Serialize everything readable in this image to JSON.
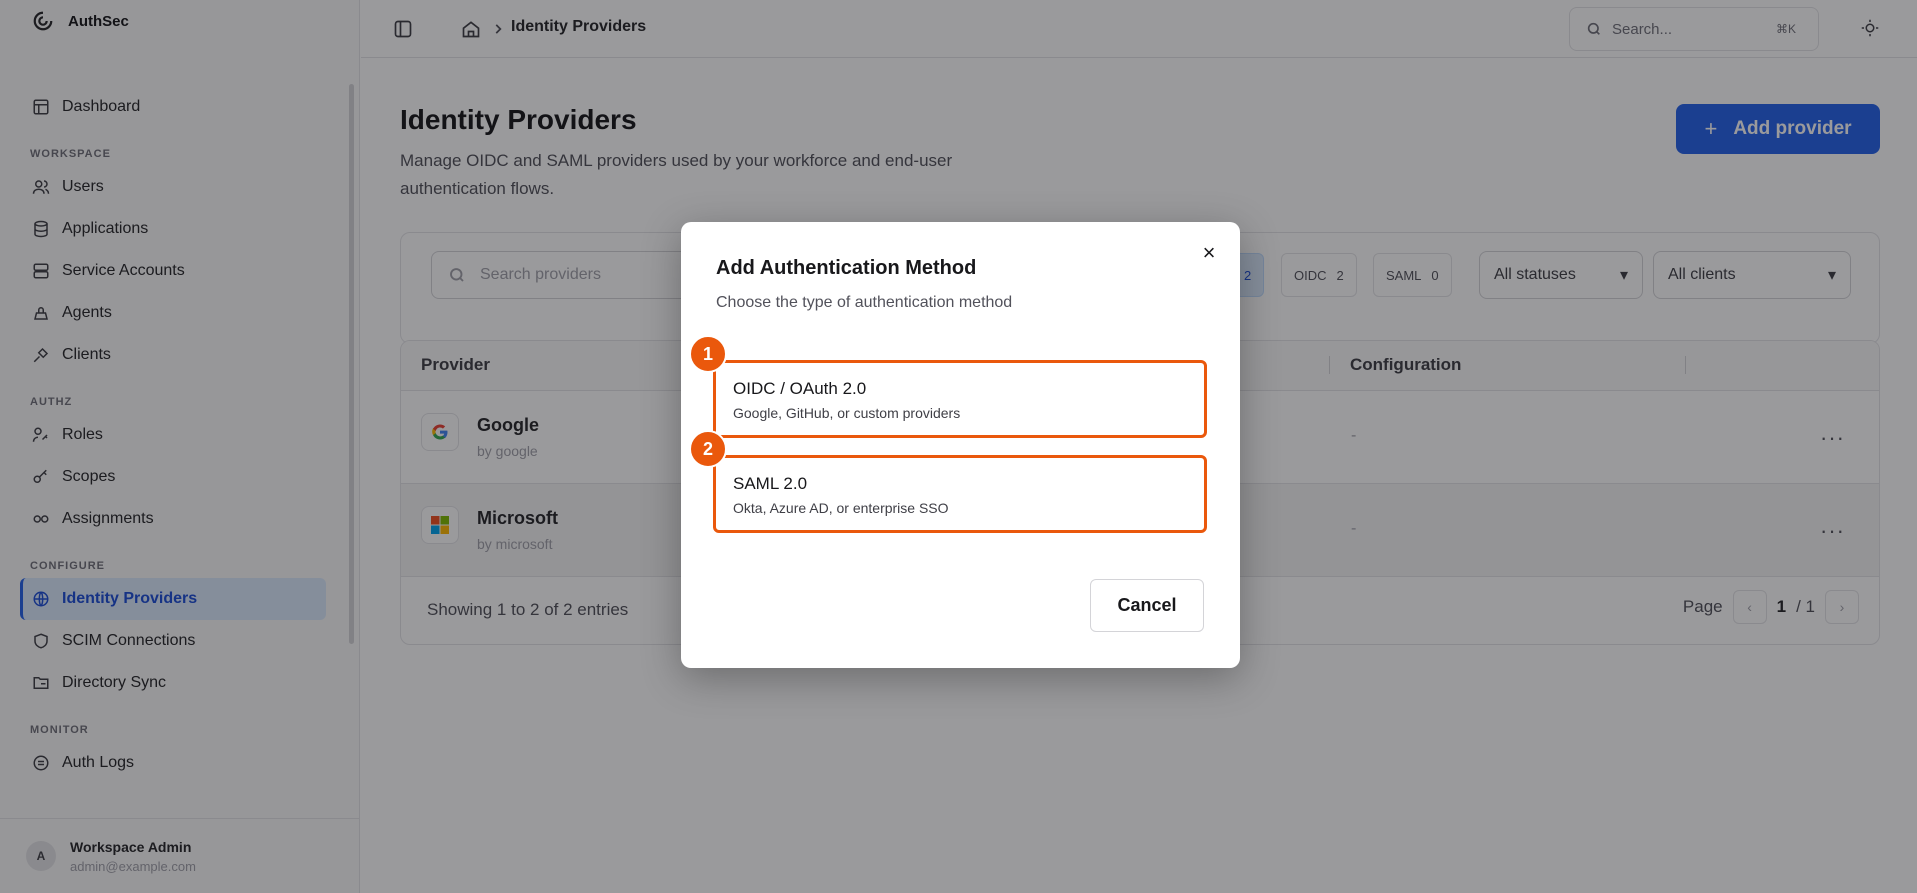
{
  "app": {
    "name": "AuthSec"
  },
  "sidebar": {
    "dashboard": "Dashboard",
    "sections": [
      {
        "label": "WORKSPACE",
        "items": [
          {
            "label": "Users",
            "icon": "users-icon"
          },
          {
            "label": "Applications",
            "icon": "database-icon"
          },
          {
            "label": "Service Accounts",
            "icon": "server-icon"
          },
          {
            "label": "Agents",
            "icon": "agent-icon"
          },
          {
            "label": "Clients",
            "icon": "plug-icon"
          }
        ]
      },
      {
        "label": "AUTHZ",
        "items": [
          {
            "label": "Roles",
            "icon": "user-key-icon"
          },
          {
            "label": "Scopes",
            "icon": "key-icon"
          },
          {
            "label": "Assignments",
            "icon": "link-icon"
          }
        ]
      },
      {
        "label": "CONFIGURE",
        "items": [
          {
            "label": "Identity Providers",
            "icon": "globe-icon",
            "active": true
          },
          {
            "label": "SCIM Connections",
            "icon": "shield-icon"
          },
          {
            "label": "Directory Sync",
            "icon": "folder-sync-icon"
          }
        ]
      },
      {
        "label": "MONITOR",
        "items": [
          {
            "label": "Auth Logs",
            "icon": "list-icon"
          }
        ]
      }
    ],
    "user": {
      "initial": "A",
      "name": "Workspace Admin",
      "email": "admin@example.com"
    }
  },
  "topbar": {
    "breadcrumb": "Identity Providers",
    "search_placeholder": "Search...",
    "search_shortcut": "⌘K"
  },
  "page": {
    "title": "Identity Providers",
    "subtitle": "Manage OIDC and SAML providers used by your workforce and end-user authentication flows.",
    "add_button": "Add provider"
  },
  "filters": {
    "search_placeholder": "Search providers",
    "chips": [
      {
        "label": "",
        "count": "2"
      },
      {
        "label": "OIDC",
        "count": "2"
      },
      {
        "label": "SAML",
        "count": "0"
      }
    ],
    "status_select": "All statuses",
    "client_select": "All clients"
  },
  "table": {
    "columns": [
      "Provider",
      "Configuration"
    ],
    "rows": [
      {
        "name": "Google",
        "by": "by google",
        "config": "-",
        "logo": "google-logo-icon"
      },
      {
        "name": "Microsoft",
        "by": "by microsoft",
        "config": "-",
        "logo": "microsoft-logo-icon"
      }
    ],
    "showing": "Showing 1 to 2 of 2 entries",
    "page_label": "Page",
    "page_current": "1",
    "page_total": "/ 1"
  },
  "modal": {
    "title": "Add Authentication Method",
    "subtitle": "Choose the type of authentication method",
    "options": [
      {
        "badge": "1",
        "title": "OIDC / OAuth 2.0",
        "desc": "Google, GitHub, or custom providers"
      },
      {
        "badge": "2",
        "title": "SAML 2.0",
        "desc": "Okta, Azure AD, or enterprise SSO"
      }
    ],
    "cancel": "Cancel"
  },
  "colors": {
    "accent": "#2563eb",
    "highlight": "#ea580c",
    "overlay": "rgba(15,15,20,0.42)"
  }
}
